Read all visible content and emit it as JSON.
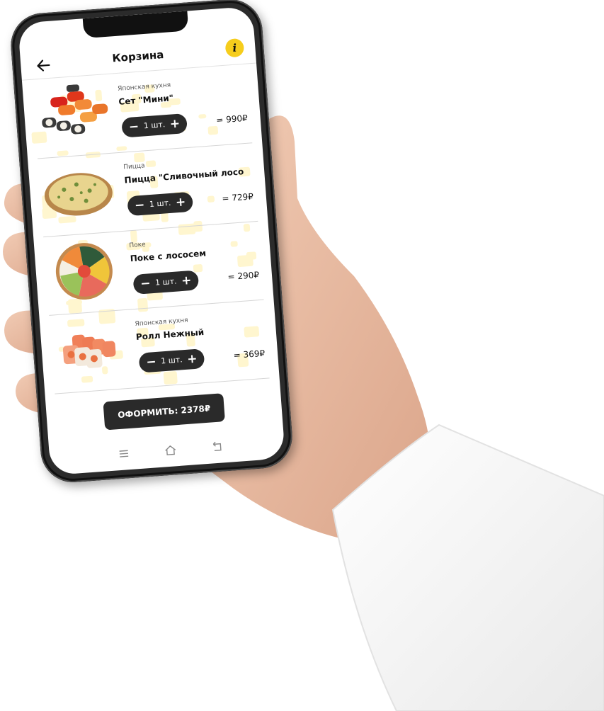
{
  "header": {
    "title": "Корзина",
    "info_glyph": "i",
    "back_icon": "arrow-left-icon",
    "info_icon": "info-icon"
  },
  "cart": {
    "items": [
      {
        "category": "Японская кухня",
        "name": "Сет \"Мини\"",
        "quantity": "1 шт.",
        "price": "= 990₽",
        "image": "sushi-set-image"
      },
      {
        "category": "Пицца",
        "name": "Пицца \"Сливочный лосо",
        "quantity": "1 шт.",
        "price": "= 729₽",
        "image": "pizza-image"
      },
      {
        "category": "Поке",
        "name": "Поке с лососем",
        "quantity": "1 шт.",
        "price": "= 290₽",
        "image": "poke-bowl-image"
      },
      {
        "category": "Японская кухня",
        "name": "Ролл Нежный",
        "quantity": "1 шт.",
        "price": "= 369₽",
        "image": "roll-image"
      }
    ],
    "minus_glyph": "−",
    "plus_glyph": "+"
  },
  "checkout": {
    "label": "ОФОРМИТЬ: 2378₽"
  },
  "navbar": {
    "icons": [
      "menu-icon",
      "home-icon",
      "back-nav-icon"
    ]
  },
  "colors": {
    "accent": "#f6cd1c",
    "dark": "#2a2a2a",
    "pattern": "#fff6cf"
  }
}
